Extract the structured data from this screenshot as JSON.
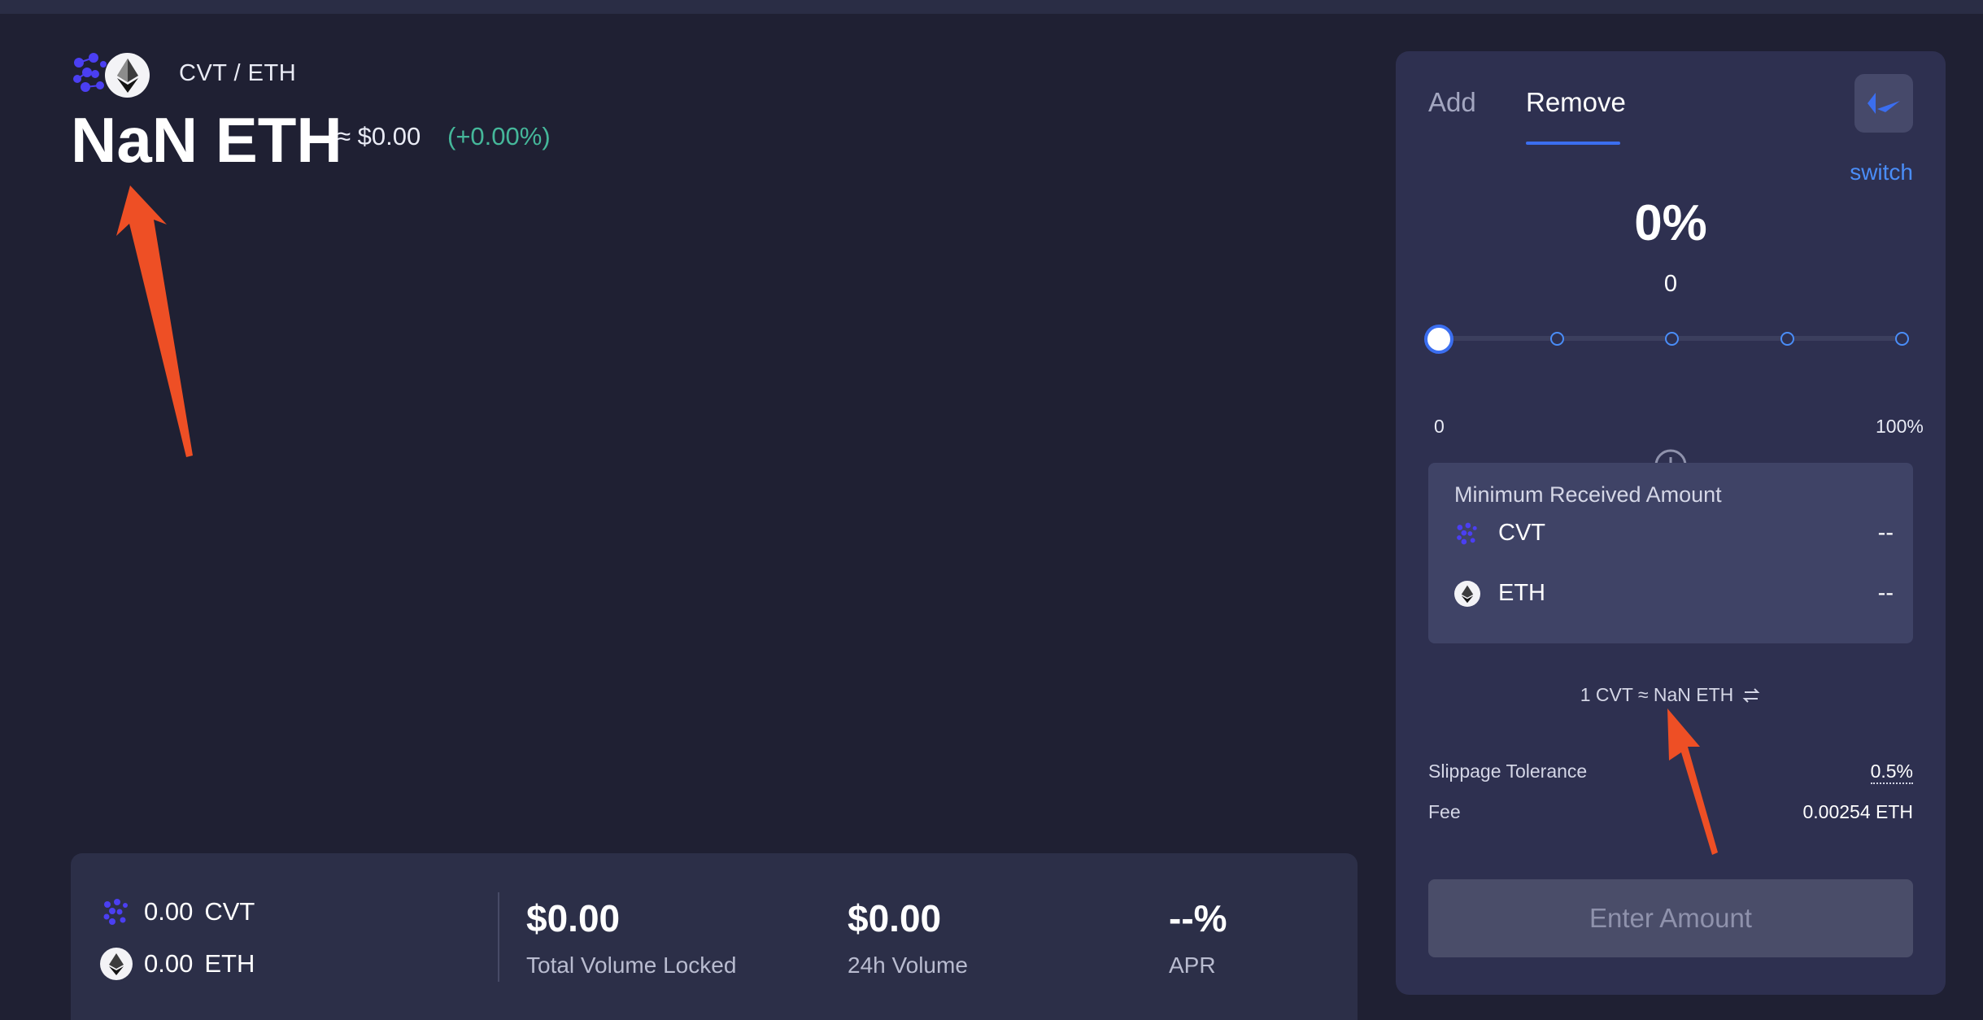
{
  "pair": {
    "name": "CVT / ETH",
    "price": "NaN ETH",
    "usd": "≈ $0.00",
    "change": "(+0.00%)"
  },
  "stats": {
    "cvt_amount": "0.00",
    "cvt_symbol": "CVT",
    "eth_amount": "0.00",
    "eth_symbol": "ETH",
    "tvl_value": "$0.00",
    "tvl_label": "Total Volume Locked",
    "volume_value": "$0.00",
    "volume_label": "24h Volume",
    "apr_value": "--%",
    "apr_label": "APR"
  },
  "panel": {
    "tabs": [
      {
        "label": "Add",
        "active": false
      },
      {
        "label": "Remove",
        "active": true
      }
    ],
    "switch_label": "switch",
    "percent": "0%",
    "amount": "0",
    "slider": {
      "value_fraction": 0,
      "min_label": "0",
      "max_label": "100%",
      "stops": [
        0,
        25,
        50,
        75,
        100
      ]
    },
    "min_received": {
      "title": "Minimum Received Amount",
      "rows": [
        {
          "symbol": "CVT",
          "value": "--"
        },
        {
          "symbol": "ETH",
          "value": "--"
        }
      ]
    },
    "rate": "1 CVT ≈ NaN ETH",
    "slippage_label": "Slippage Tolerance",
    "slippage_value": "0.5%",
    "fee_label": "Fee",
    "fee_value": "0.00254 ETH",
    "enter_button": "Enter Amount"
  },
  "colors": {
    "background": "#1f2033",
    "panel": "#2e3050",
    "accent": "#3b6ef0",
    "link": "#4a8df8",
    "positive": "#45b79a",
    "annotation": "#ee4f25"
  }
}
